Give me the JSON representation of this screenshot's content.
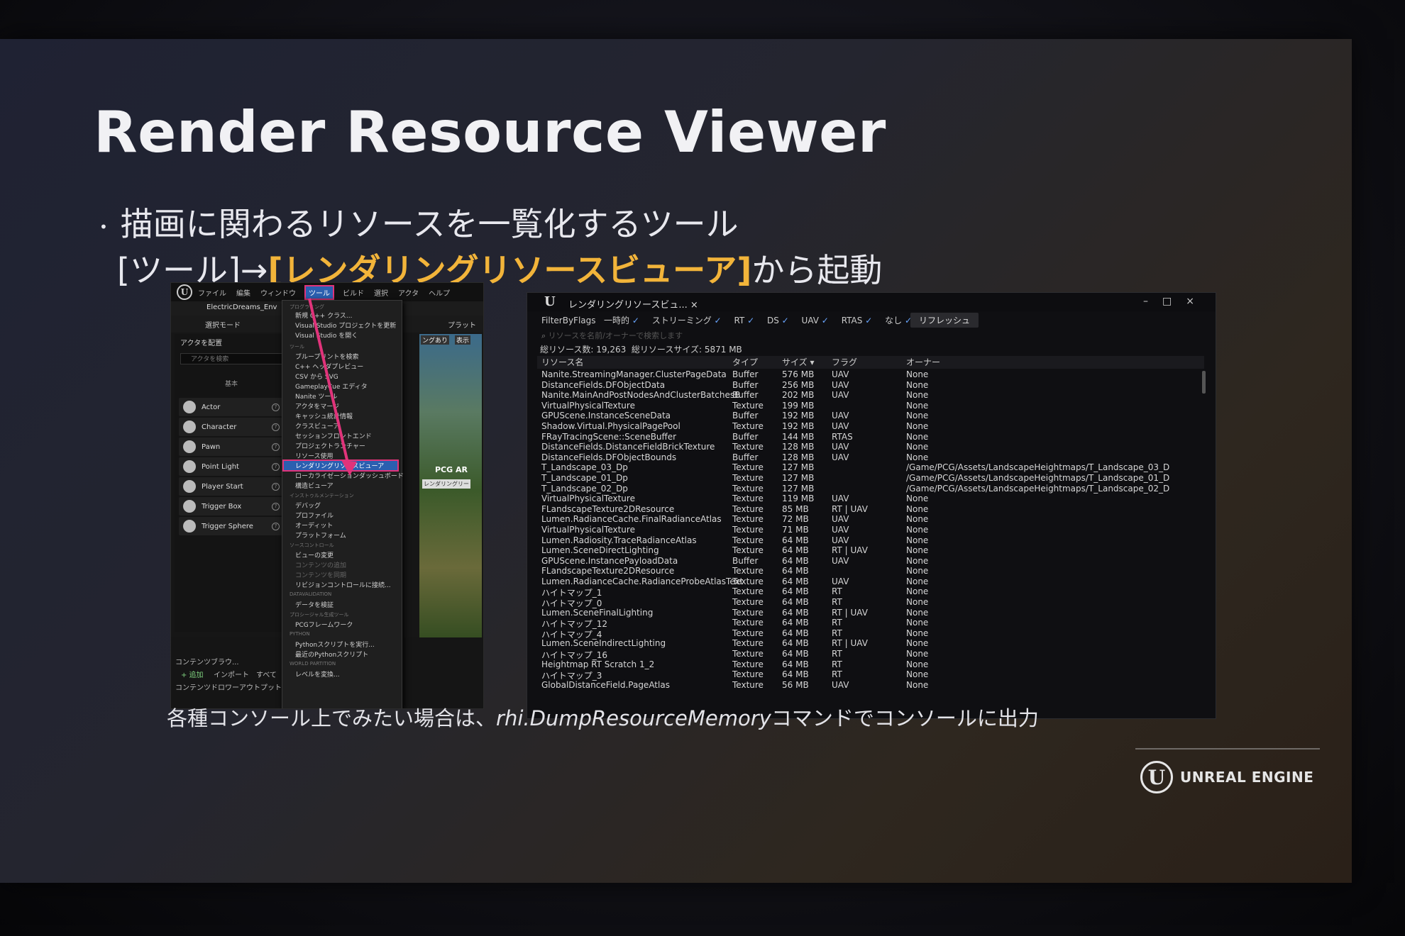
{
  "slide": {
    "title": "Render Resource Viewer",
    "bullet_line1": "描画に関わるリソースを一覧化するツール",
    "bullet_line2_prefix": "[ツール]→",
    "bullet_line2_highlight": "[レンダリングリソースビューア]",
    "bullet_line2_suffix": "から起動",
    "note_prefix": "各種コンソール上でみたい場合は、",
    "note_command": "rhi.DumpResourceMemory",
    "note_suffix": "コマンドでコンソールに出力",
    "brand": "UNREAL ENGINE",
    "brand_mark": "U",
    "highlight_color": "#f2b43a"
  },
  "editor": {
    "logo": "U",
    "menus": [
      "ファイル",
      "編集",
      "ウィンドウ",
      "ツール",
      "ビルド",
      "選択",
      "アクタ",
      "ヘルプ"
    ],
    "active_menu": "ツール",
    "tab": "ElectricDreams_Env",
    "mode": "選択モード",
    "platform": "プラット",
    "panel_title": "アクタを配置",
    "search_placeholder": "アクタを検索",
    "basic_label": "基本",
    "actors": [
      "Actor",
      "Character",
      "Pawn",
      "Point Light",
      "Player Start",
      "Trigger Box",
      "Trigger Sphere"
    ],
    "content_items": [
      "コンテンツブラウ...",
      "+ 追加",
      "インポート",
      "すべて",
      "コンテンツドロワー",
      "アウトプット"
    ],
    "viewport_labels": [
      "ングあり",
      "表示",
      "PCG AR",
      "レンダリングリー"
    ],
    "menu_items": [
      {
        "label": "新規 C++ クラス...",
        "selected": false
      },
      {
        "label": "Visual Studio プロジェクトを更新",
        "selected": false
      },
      {
        "label": "Visual Studio を開く",
        "selected": false
      },
      {
        "label": "ブループリントを検索",
        "selected": false
      },
      {
        "label": "C++ ヘッダプレビュー",
        "selected": false
      },
      {
        "label": "CSV から SVG",
        "selected": false
      },
      {
        "label": "GameplayCue エディタ",
        "selected": false
      },
      {
        "label": "Nanite ツール",
        "selected": false
      },
      {
        "label": "アクタをマージ",
        "selected": false
      },
      {
        "label": "キャッシュ統計情報",
        "selected": false
      },
      {
        "label": "クラスビューア",
        "selected": false
      },
      {
        "label": "セッションフロントエンド",
        "selected": false
      },
      {
        "label": "プロジェクトランチャー",
        "selected": false
      },
      {
        "label": "リソース使用",
        "selected": false
      },
      {
        "label": "レンダリングリソースビューア",
        "selected": true
      },
      {
        "label": "ローカライゼーションダッシュボード",
        "selected": false
      },
      {
        "label": "構造ビューア",
        "selected": false
      },
      {
        "label": "デバッグ",
        "selected": false
      },
      {
        "label": "プロファイル",
        "selected": false
      },
      {
        "label": "オーディット",
        "selected": false
      },
      {
        "label": "プラットフォーム",
        "selected": false
      },
      {
        "label": "ビューの変更",
        "selected": false
      },
      {
        "label": "コンテンツの追加",
        "selected": false
      },
      {
        "label": "コンテンツを同期",
        "selected": false
      },
      {
        "label": "リビジョンコントロールに接続...",
        "selected": false
      },
      {
        "label": "データを検証",
        "selected": false
      },
      {
        "label": "PCGフレームワーク",
        "selected": false
      },
      {
        "label": "Pythonスクリプトを実行...",
        "selected": false
      },
      {
        "label": "最近のPythonスクリプト",
        "selected": false
      },
      {
        "label": "レベルを変換...",
        "selected": false
      }
    ],
    "menu_sections": [
      "プログラミング",
      "ツール",
      "インストゥルメンテーション",
      "ソースコントロール",
      "DATAVALIDATION",
      "プロシージャル生成ツール",
      "PYTHON",
      "WORLD PARTITION"
    ]
  },
  "viewer": {
    "logo": "U",
    "tab": "レンダリングリソースビュ...",
    "tab_close": "×",
    "window_controls": [
      "–",
      "□",
      "×"
    ],
    "filter_label": "FilterByFlags",
    "filters": [
      "一時的",
      "ストリーミング",
      "RT",
      "DS",
      "UAV",
      "RTAS",
      "なし"
    ],
    "refresh_label": "リフレッシュ",
    "search_placeholder": "リソースを名前/オーナーで検索します",
    "totals_label": "総リソース数:",
    "totals_count": "19,263",
    "totals_size_label": "総リソースサイズ:",
    "totals_size": "5871 MB",
    "columns": [
      "リソース名",
      "タイプ",
      "サイズ ▾",
      "フラグ",
      "オーナー"
    ],
    "rows": [
      [
        "Nanite.StreamingManager.ClusterPageData",
        "Buffer",
        "576 MB",
        "UAV",
        "None"
      ],
      [
        "DistanceFields.DFObjectData",
        "Buffer",
        "256 MB",
        "UAV",
        "None"
      ],
      [
        "Nanite.MainAndPostNodesAndClusterBatchesB",
        "Buffer",
        "202 MB",
        "UAV",
        "None"
      ],
      [
        "VirtualPhysicalTexture",
        "Texture",
        "199 MB",
        "",
        "None"
      ],
      [
        "GPUScene.InstanceSceneData",
        "Buffer",
        "192 MB",
        "UAV",
        "None"
      ],
      [
        "Shadow.Virtual.PhysicalPagePool",
        "Texture",
        "192 MB",
        "UAV",
        "None"
      ],
      [
        "FRayTracingScene::SceneBuffer",
        "Buffer",
        "144 MB",
        "RTAS",
        "None"
      ],
      [
        "DistanceFields.DistanceFieldBrickTexture",
        "Texture",
        "128 MB",
        "UAV",
        "None"
      ],
      [
        "DistanceFields.DFObjectBounds",
        "Buffer",
        "128 MB",
        "UAV",
        "None"
      ],
      [
        "T_Landscape_03_Dp",
        "Texture",
        "127 MB",
        "",
        "/Game/PCG/Assets/LandscapeHeightmaps/T_Landscape_03_D"
      ],
      [
        "T_Landscape_01_Dp",
        "Texture",
        "127 MB",
        "",
        "/Game/PCG/Assets/LandscapeHeightmaps/T_Landscape_01_D"
      ],
      [
        "T_Landscape_02_Dp",
        "Texture",
        "127 MB",
        "",
        "/Game/PCG/Assets/LandscapeHeightmaps/T_Landscape_02_D"
      ],
      [
        "VirtualPhysicalTexture",
        "Texture",
        "119 MB",
        "UAV",
        "None"
      ],
      [
        "FLandscapeTexture2DResource",
        "Texture",
        "85 MB",
        "RT | UAV",
        "None"
      ],
      [
        "Lumen.RadianceCache.FinalRadianceAtlas",
        "Texture",
        "72 MB",
        "UAV",
        "None"
      ],
      [
        "VirtualPhysicalTexture",
        "Texture",
        "71 MB",
        "UAV",
        "None"
      ],
      [
        "Lumen.Radiosity.TraceRadianceAtlas",
        "Texture",
        "64 MB",
        "UAV",
        "None"
      ],
      [
        "Lumen.SceneDirectLighting",
        "Texture",
        "64 MB",
        "RT | UAV",
        "None"
      ],
      [
        "GPUScene.InstancePayloadData",
        "Buffer",
        "64 MB",
        "UAV",
        "None"
      ],
      [
        "FLandscapeTexture2DResource",
        "Texture",
        "64 MB",
        "",
        "None"
      ],
      [
        "Lumen.RadianceCache.RadianceProbeAtlasText",
        "Texture",
        "64 MB",
        "UAV",
        "None"
      ],
      [
        "ハイトマップ_1",
        "Texture",
        "64 MB",
        "RT",
        "None"
      ],
      [
        "ハイトマップ_0",
        "Texture",
        "64 MB",
        "RT",
        "None"
      ],
      [
        "Lumen.SceneFinalLighting",
        "Texture",
        "64 MB",
        "RT | UAV",
        "None"
      ],
      [
        "ハイトマップ_12",
        "Texture",
        "64 MB",
        "RT",
        "None"
      ],
      [
        "ハイトマップ_4",
        "Texture",
        "64 MB",
        "RT",
        "None"
      ],
      [
        "Lumen.SceneIndirectLighting",
        "Texture",
        "64 MB",
        "RT | UAV",
        "None"
      ],
      [
        "ハイトマップ_16",
        "Texture",
        "64 MB",
        "RT",
        "None"
      ],
      [
        "Heightmap RT Scratch 1_2",
        "Texture",
        "64 MB",
        "RT",
        "None"
      ],
      [
        "ハイトマップ_3",
        "Texture",
        "64 MB",
        "RT",
        "None"
      ],
      [
        "GlobalDistanceField.PageAtlas",
        "Texture",
        "56 MB",
        "UAV",
        "None"
      ]
    ]
  }
}
